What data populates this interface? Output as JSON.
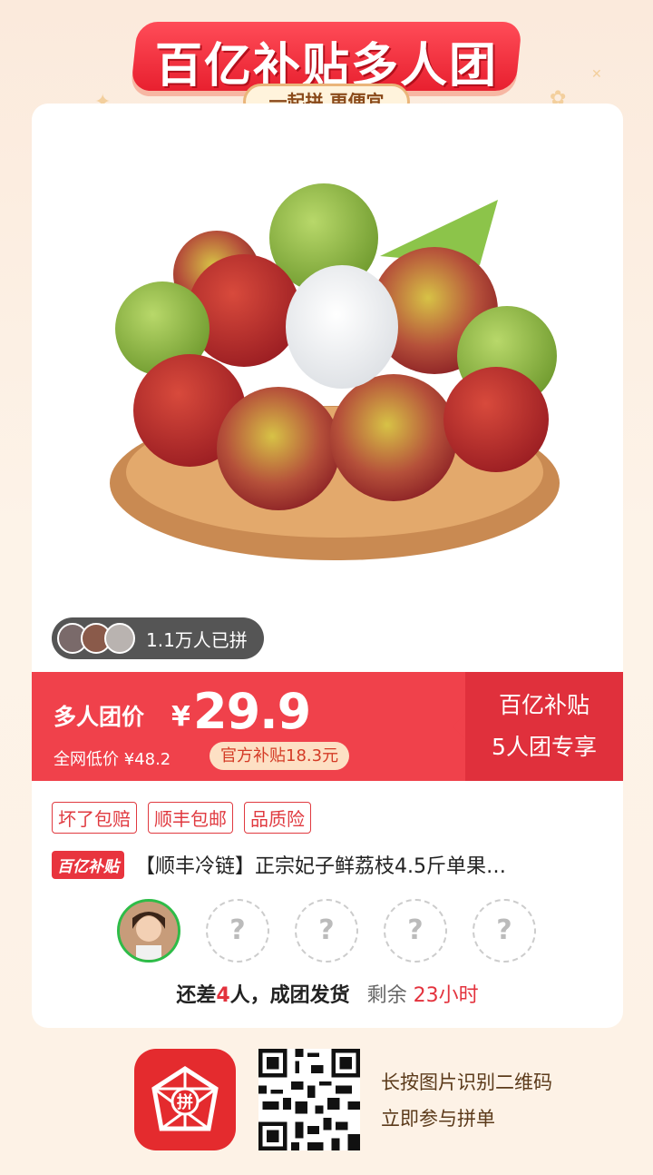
{
  "banner": {
    "title": "百亿补贴多人团",
    "subtitle": "一起拼 更便宜"
  },
  "joined": {
    "text": "1.1万人已拼"
  },
  "price": {
    "label": "多人团价",
    "currency": "¥",
    "value": "29.9",
    "original": "全网低价 ¥48.2",
    "subsidy": "官方补贴18.3元",
    "side_line1": "百亿补贴",
    "side_line2": "5人团专享"
  },
  "tags": [
    "坏了包赔",
    "顺丰包邮",
    "品质险"
  ],
  "product": {
    "badge": "百亿补贴",
    "title": "【顺丰冷链】正宗妃子鲜荔枝4.5斤单果…"
  },
  "slots": {
    "placeholder": "?"
  },
  "status": {
    "prefix": "还差",
    "count": "4",
    "suffix": "人，成团发货",
    "remain_label": "剩余",
    "remain_time": "23小时"
  },
  "footer": {
    "line1": "长按图片识别二维码",
    "line2": "立即参与拼单",
    "logo_char": "拼"
  },
  "colors": {
    "brand_red": "#e42b2e",
    "price_red": "#f0414b",
    "leader_ring": "#2ebc48"
  }
}
